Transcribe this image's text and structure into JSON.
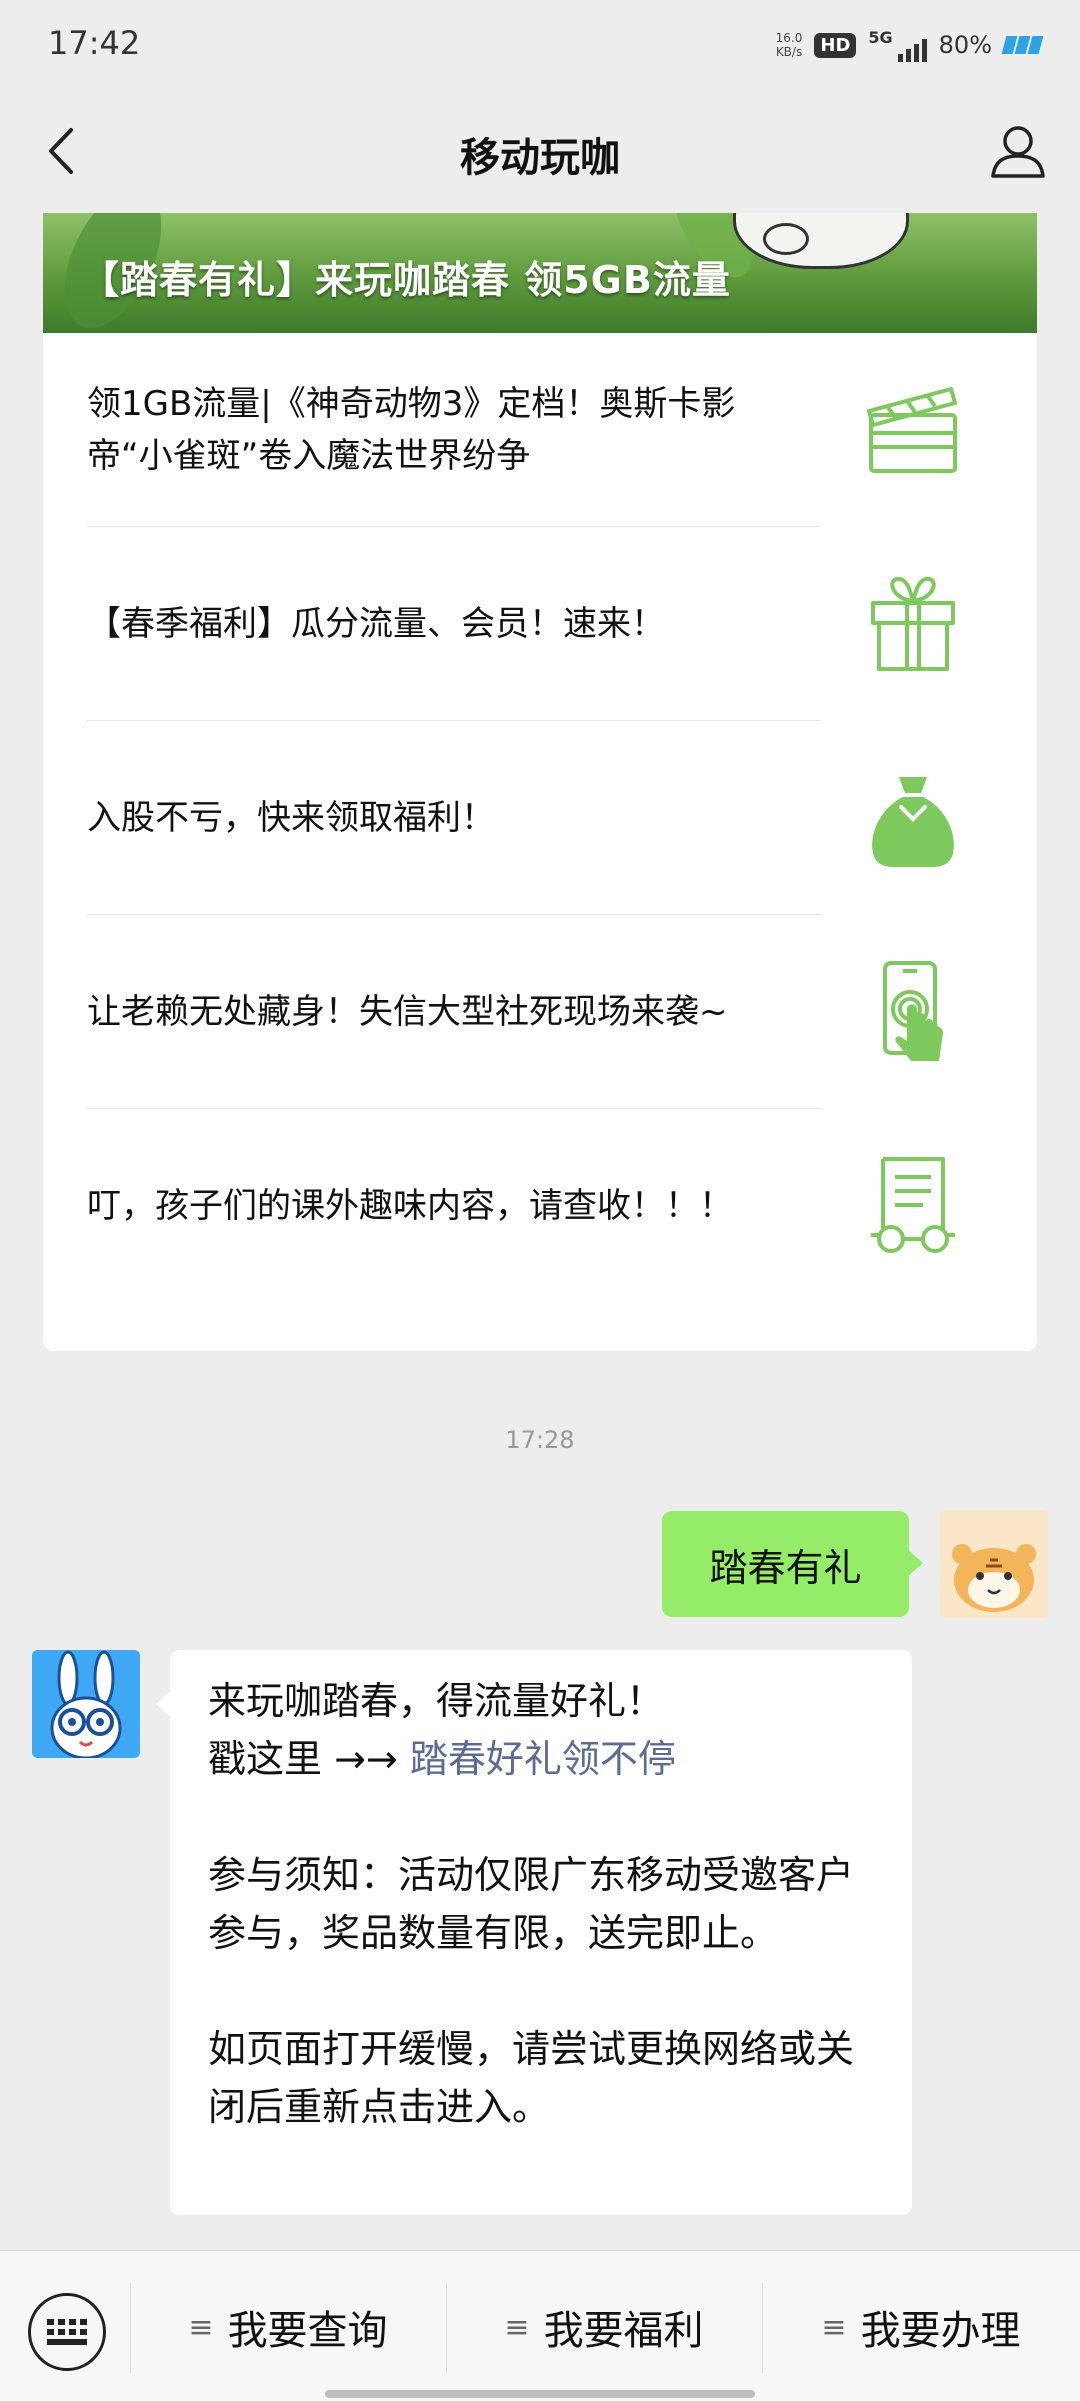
{
  "status": {
    "time": "17:42",
    "net_speed_value": "16.0",
    "net_speed_unit": "KB/s",
    "hd": "HD",
    "network": "5G",
    "battery": "80%"
  },
  "header": {
    "title": "移动玩咖"
  },
  "card": {
    "banner_title": "【踏春有礼】来玩咖踏春 领5GB流量",
    "items": [
      {
        "text": "领1GB流量|《神奇动物3》定档！奥斯卡影帝“小雀斑”卷入魔法世界纷争",
        "icon": "clapperboard-icon"
      },
      {
        "text": "【春季福利】瓜分流量、会员！速来！",
        "icon": "gift-box-icon"
      },
      {
        "text": "入股不亏，快来领取福利！",
        "icon": "money-bag-icon"
      },
      {
        "text": "让老赖无处藏身！失信大型社死现场来袭~",
        "icon": "phone-touch-icon"
      },
      {
        "text": "叮，孩子们的课外趣味内容，请查收！！！",
        "icon": "document-glasses-icon"
      }
    ]
  },
  "chat": {
    "time": "17:28",
    "my_message": "踏春有礼",
    "bot_lines": {
      "line1": "来玩咖踏春，得流量好礼！",
      "line2_prefix": "戳这里 →→ ",
      "line2_link": "踏春好礼领不停",
      "notice": "参与须知：活动仅限广东移动受邀客户参与，奖品数量有限，送完即止。",
      "tip": "如页面打开缓慢，请尝试更换网络或关闭后重新点击进入。"
    }
  },
  "bottom_menu": {
    "items": [
      "我要查询",
      "我要福利",
      "我要办理"
    ]
  },
  "colors": {
    "background": "#ededed",
    "my_bubble": "#95ec69",
    "link": "#5b6b92",
    "icon_green": "#7dc95e"
  }
}
